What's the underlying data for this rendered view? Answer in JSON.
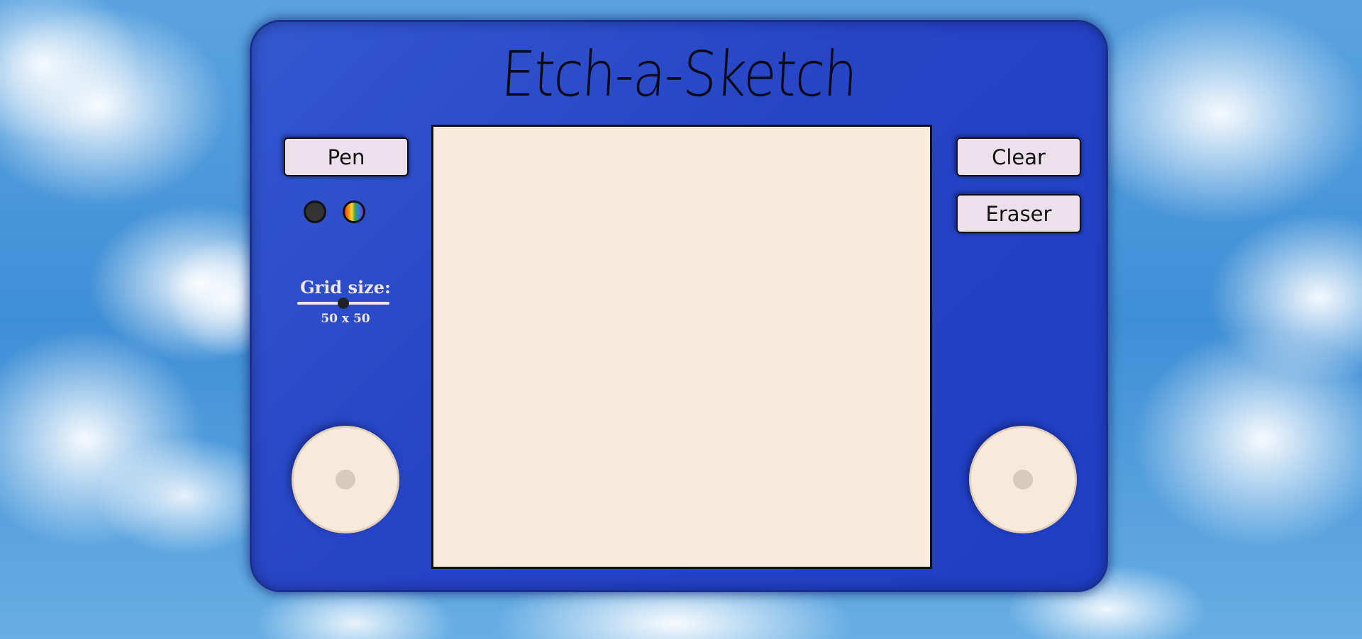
{
  "app": {
    "title": "Etch-a-Sketch"
  },
  "controls": {
    "pen_label": "Pen",
    "clear_label": "Clear",
    "eraser_label": "Eraser"
  },
  "colors": {
    "device_body": "#2644c6",
    "screen": "#f9ebdc",
    "button": "#ece0ea",
    "swatches": [
      {
        "name": "black",
        "icon": "black-color-swatch"
      },
      {
        "name": "rainbow",
        "icon": "rainbow-color-swatch"
      }
    ]
  },
  "grid": {
    "label": "Grid size:",
    "value_text": "50 x 50",
    "value": 50
  }
}
